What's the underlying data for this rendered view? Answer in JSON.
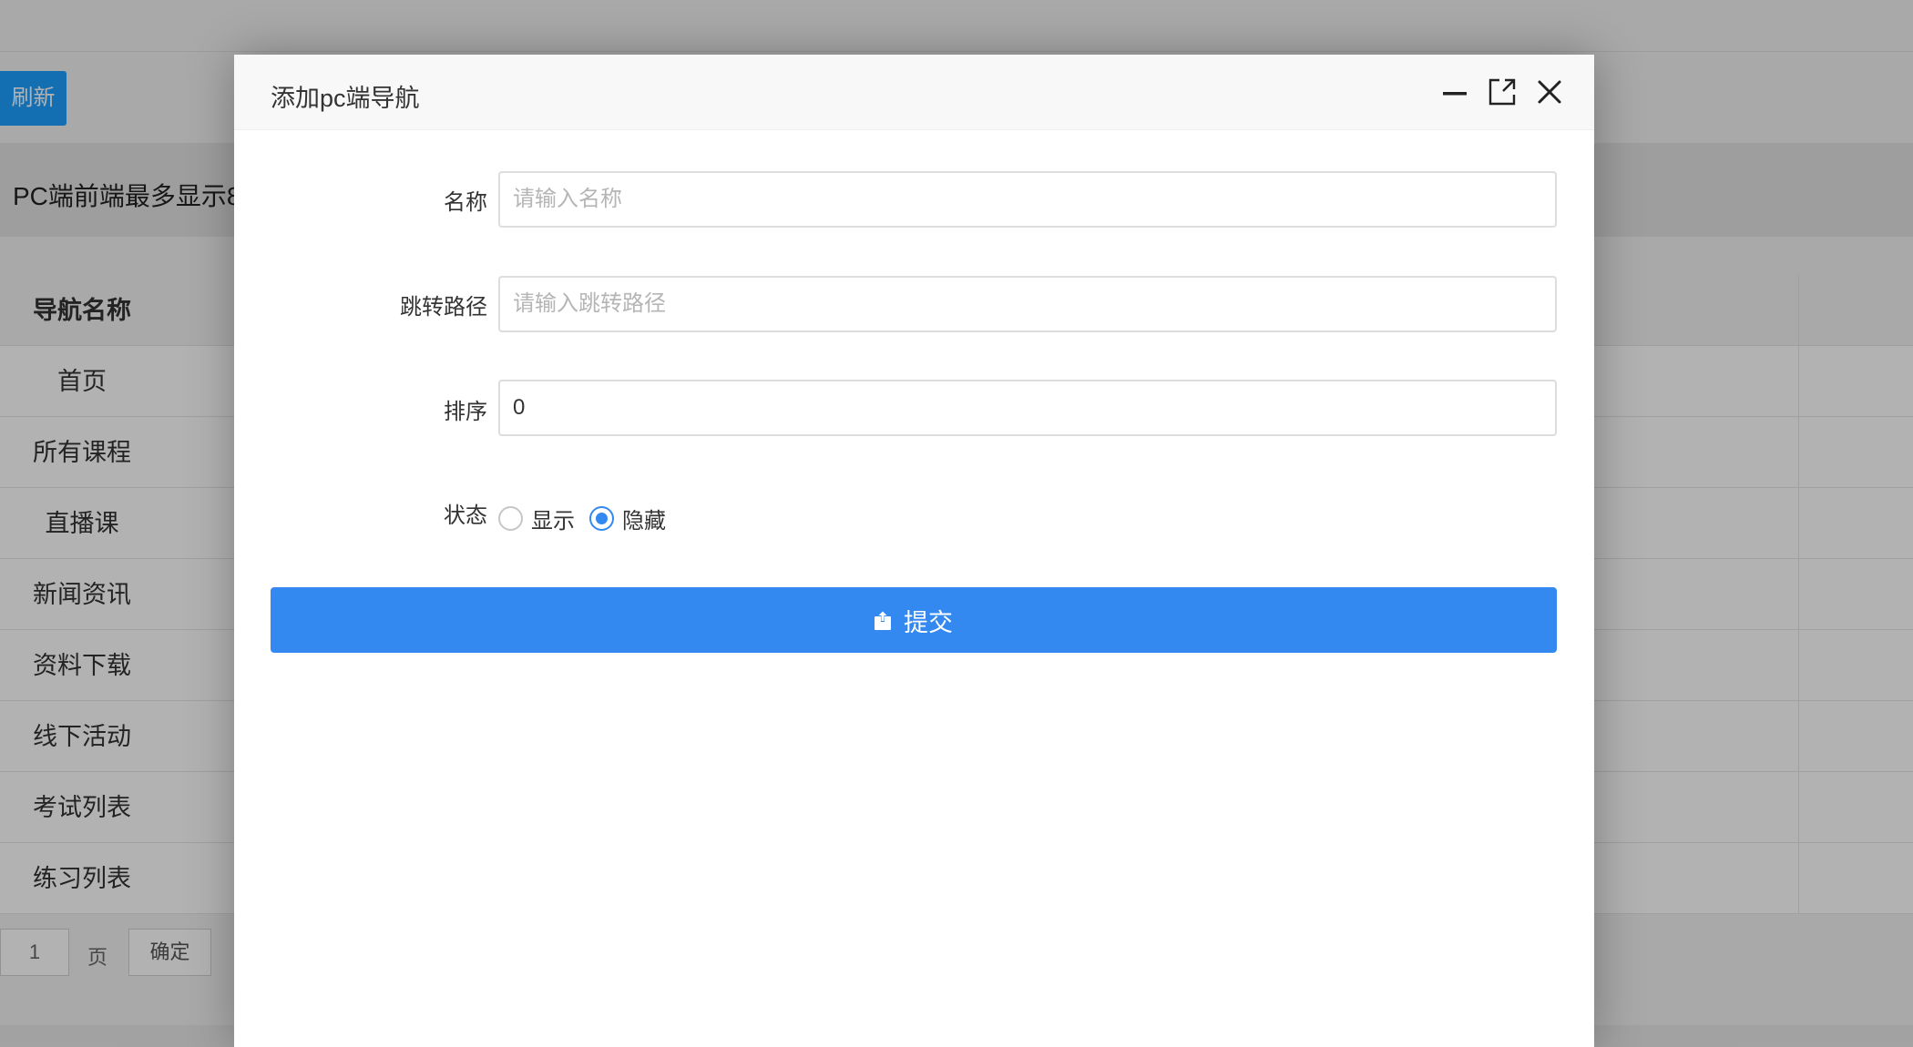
{
  "background": {
    "refresh_label": "刷新",
    "notice_text": "PC端前端最多显示8",
    "table": {
      "header_name": "导航名称",
      "rows": [
        "首页",
        "所有课程",
        "直播课",
        "新闻资讯",
        "资料下载",
        "线下活动",
        "考试列表",
        "练习列表"
      ]
    },
    "pager": {
      "page_value": "1",
      "page_label": "页",
      "confirm_label": "确定"
    }
  },
  "modal": {
    "title": "添加pc端导航",
    "icons": {
      "minimize": "minimize-icon",
      "maximize": "maximize-icon",
      "close": "close-icon"
    },
    "form": {
      "name_label": "名称",
      "name_placeholder": "请输入名称",
      "name_value": "",
      "path_label": "跳转路径",
      "path_placeholder": "请输入跳转路径",
      "path_value": "",
      "sort_label": "排序",
      "sort_value": "0",
      "status_label": "状态",
      "status_options": [
        "显示",
        "隐藏"
      ],
      "status_selected": "隐藏"
    },
    "submit_label": "提交",
    "submit_icon": "upload-icon"
  },
  "colors": {
    "accent": "#3389f0",
    "refresh_button": "#1e9fff"
  }
}
